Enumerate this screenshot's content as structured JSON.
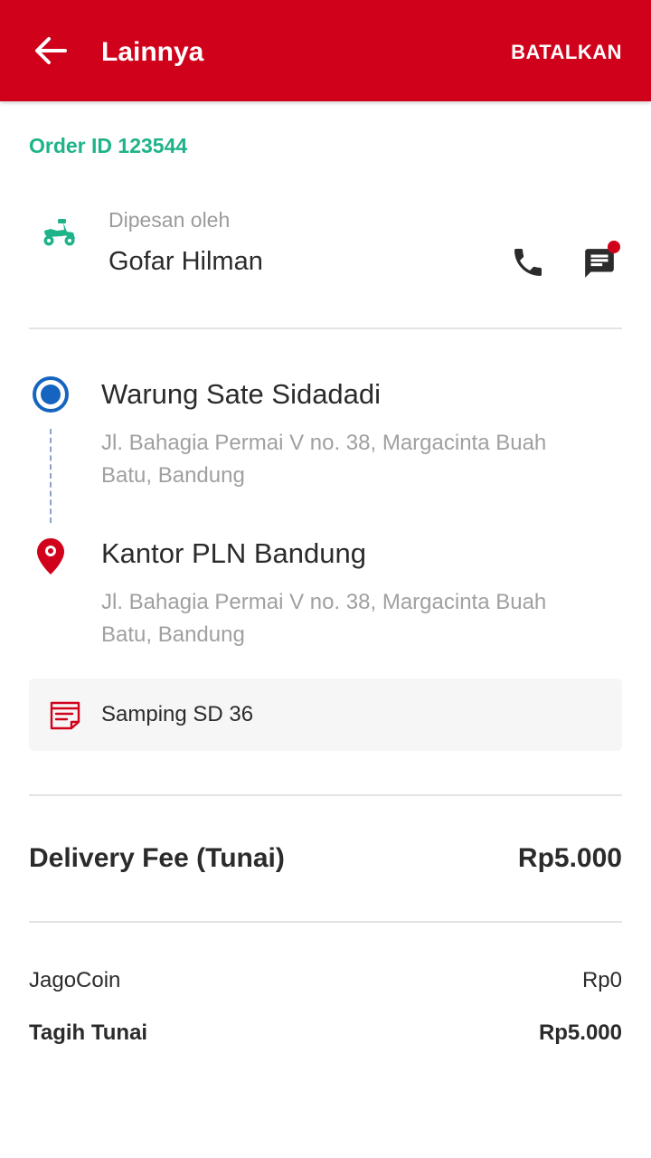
{
  "appbar": {
    "title": "Lainnya",
    "cancel_label": "BATALKAN",
    "back_icon": "arrow-left-icon"
  },
  "order": {
    "id_label": "Order ID 123544"
  },
  "customer": {
    "ordered_by_label": "Dipesan oleh",
    "name": "Gofar Hilman",
    "vehicle_icon": "scooter-icon",
    "phone_icon": "phone-icon",
    "chat_icon": "chat-icon"
  },
  "route": {
    "pickup": {
      "name": "Warung Sate Sidadadi",
      "address": "Jl. Bahagia Permai V no. 38, Margacinta Buah Batu, Bandung"
    },
    "dropoff": {
      "name": "Kantor PLN Bandung",
      "address": "Jl. Bahagia Permai V no. 38, Margacinta Buah Batu, Bandung"
    }
  },
  "note": {
    "text": "Samping SD 36",
    "icon": "note-icon"
  },
  "fees": {
    "delivery_label": "Delivery Fee (Tunai)",
    "delivery_value": "Rp5.000",
    "jagocoin_label": "JagoCoin",
    "jagocoin_value": "Rp0",
    "tagih_label": "Tagih Tunai",
    "tagih_value": "Rp5.000"
  },
  "colors": {
    "brand_red": "#d0021b",
    "accent_green": "#1fb389",
    "pickup_blue": "#1565c0"
  }
}
